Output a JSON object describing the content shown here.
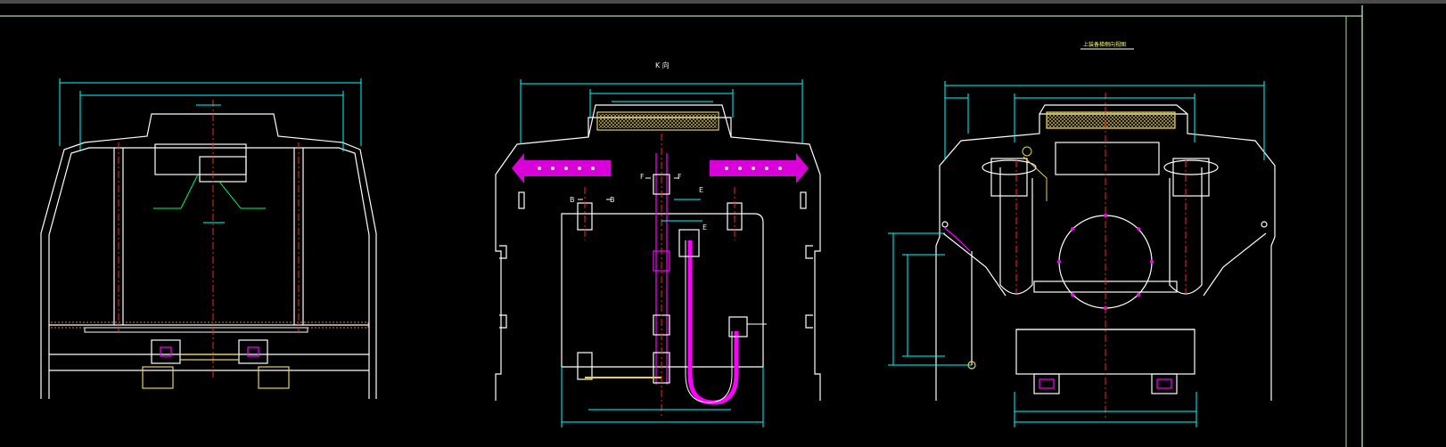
{
  "colors": {
    "background": "#000000",
    "outline": "#ffffff",
    "dimension": "#00ffff",
    "centerline": "#ff2222",
    "pipe": "#ff00ff",
    "grating": "#e8d24a",
    "border": "#a8d8a8",
    "leader": "#00ff66",
    "hatch": "#d08a3a"
  },
  "views": {
    "center": {
      "title": "K 向",
      "sections": {
        "b_left": "B",
        "b_right": "B",
        "f_left": "F",
        "f_right": "F",
        "e_top": "E",
        "e_mid": "E"
      }
    },
    "right": {
      "title": "上装备梯侧向视图"
    }
  }
}
